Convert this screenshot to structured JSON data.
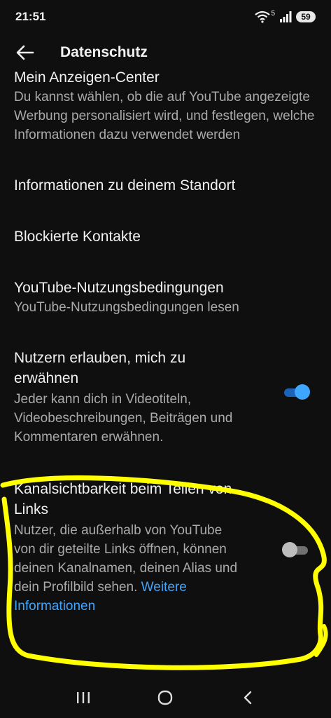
{
  "status_bar": {
    "time": "21:51",
    "wifi_label": "5",
    "battery": "59"
  },
  "app_bar": {
    "title": "Datenschutz",
    "back_icon": "arrow-left-icon"
  },
  "items": [
    {
      "title": "Mein Anzeigen-Center",
      "description": "Du kannst wählen, ob die auf YouTube angezeigte Werbung personalisiert wird, und festlegen, welche Informationen dazu verwendet werden"
    },
    {
      "title": "Informationen zu deinem Standort"
    },
    {
      "title": "Blockierte Kontakte"
    },
    {
      "title": "YouTube-Nutzungsbedingungen",
      "description": "YouTube-Nutzungsbedingungen lesen"
    },
    {
      "title": "Nutzern erlauben, mich zu erwähnen",
      "description": "Jeder kann dich in Videotiteln, Videobeschreibungen, Beiträgen und Kommentaren erwähnen.",
      "toggle": "on"
    },
    {
      "title": "Kanalsichtbarkeit beim Teilen von Links",
      "description": "Nutzer, die außerhalb von YouTube von dir geteilte Links öffnen, können deinen Kanalnamen, deinen Alias und dein Profilbild sehen.",
      "link": "Weitere Informationen",
      "toggle": "off"
    }
  ],
  "colors": {
    "background": "#0f0f0f",
    "text": "#f1f1f1",
    "secondary_text": "#aaaaaa",
    "link": "#3ea6ff",
    "annotation": "#ffff00"
  },
  "nav_bar": {
    "recents_icon": "recents-icon",
    "home_icon": "home-icon",
    "back_icon": "back-chevron-icon"
  }
}
